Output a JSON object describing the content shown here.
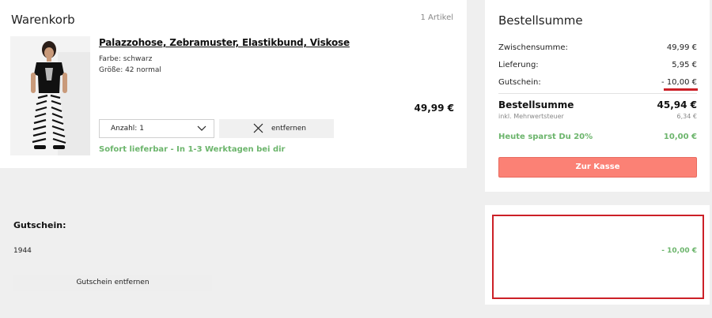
{
  "cart": {
    "title": "Warenkorb",
    "count": "1 Artikel",
    "item": {
      "name": "Palazzohose, Zebramuster, Elastikbund, Viskose",
      "color": "Farbe: schwarz",
      "size": "Größe: 42 normal",
      "price": "49,99 €",
      "quantity": "Anzahl: 1",
      "remove_label": "entfernen",
      "delivery": "Sofort lieferbar - In 1-3 Werktagen bei dir"
    }
  },
  "summary": {
    "title": "Bestellsumme",
    "rows": [
      {
        "label": "Zwischensumme:",
        "value": "49,99 €"
      },
      {
        "label": "Lieferung:",
        "value": "5,95 €"
      },
      {
        "label": "Gutschein:",
        "value": "- 10,00 €"
      }
    ],
    "total_label": "Bestellsumme",
    "total_value": "45,94 €",
    "vat_label": "inkl. Mehrwertsteuer",
    "vat_value": "6,34 €",
    "savings_label": "Heute sparst Du 20%",
    "savings_value": "10,00 €",
    "checkout_label": "Zur Kasse"
  },
  "voucher": {
    "title": "Gutschein:",
    "code": "1944",
    "amount": "- 10,00 €",
    "remove_label": "Gutschein entfernen"
  },
  "colors": {
    "accent_green": "#6cb56c",
    "checkout_button": "#fb8175",
    "highlight_red": "#cc2027"
  },
  "icons": [
    "product-photo",
    "chevron-down-icon",
    "close-icon"
  ]
}
